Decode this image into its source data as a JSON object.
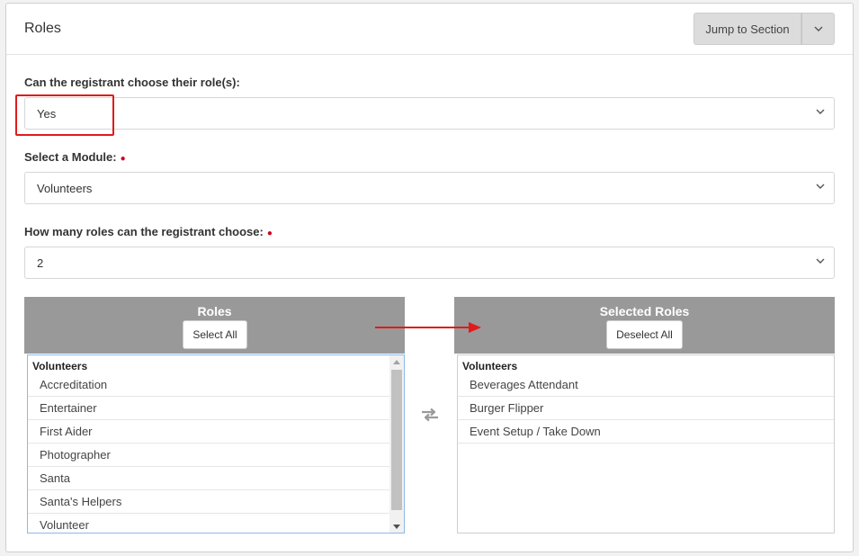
{
  "header": {
    "title": "Roles",
    "jump_label": "Jump to Section"
  },
  "fields": {
    "choose_label": "Can the registrant choose their role(s):",
    "choose_value": "Yes",
    "module_label": "Select a Module:",
    "module_value": "Volunteers",
    "count_label": "How many roles can the registrant choose:",
    "count_value": "2"
  },
  "available": {
    "title": "Roles",
    "button": "Select All",
    "group": "Volunteers",
    "items": [
      "Accreditation",
      "Entertainer",
      "First Aider",
      "Photographer",
      "Santa",
      "Santa's Helpers",
      "Volunteer"
    ]
  },
  "selected": {
    "title": "Selected Roles",
    "button": "Deselect All",
    "group": "Volunteers",
    "items": [
      "Beverages Attendant",
      "Burger Flipper",
      "Event Setup / Take Down"
    ]
  },
  "colors": {
    "annotation": "#e01b1b",
    "header_bg": "#999999",
    "required": "#d0021b"
  }
}
